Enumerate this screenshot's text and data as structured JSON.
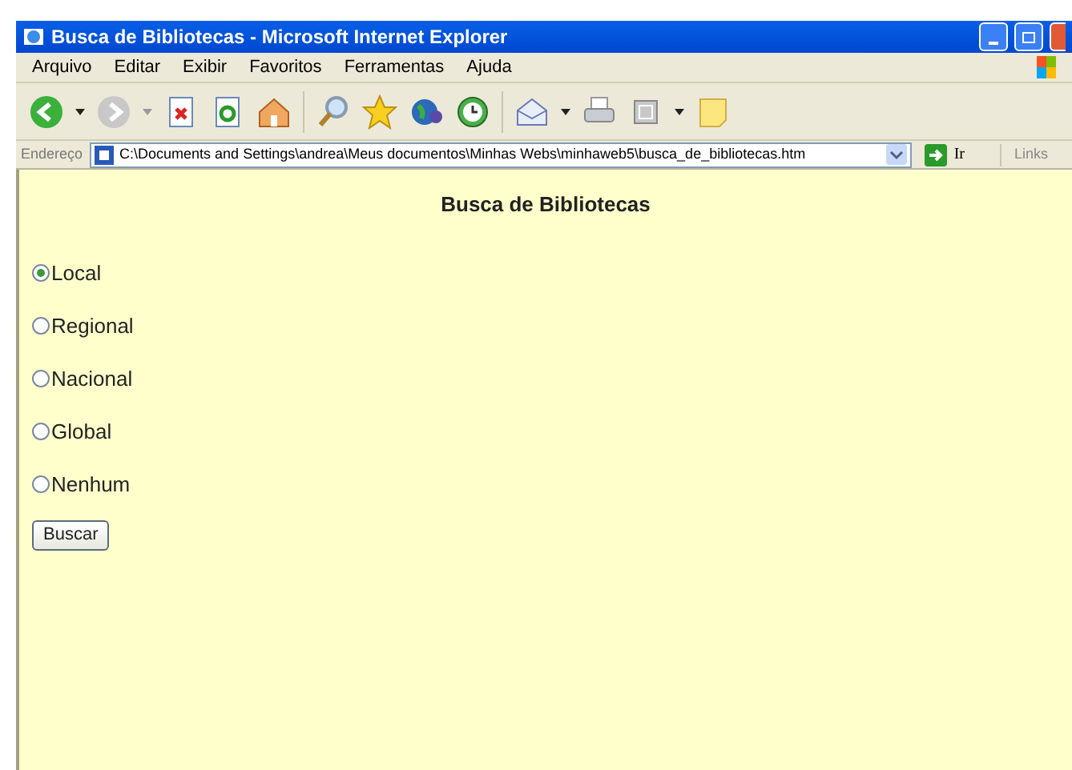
{
  "window": {
    "title": "Busca de Bibliotecas - Microsoft Internet Explorer"
  },
  "menu": [
    "Arquivo",
    "Editar",
    "Exibir",
    "Favoritos",
    "Ferramentas",
    "Ajuda"
  ],
  "address_bar": {
    "label": "Endereço",
    "value": "C:\\Documents and Settings\\andrea\\Meus documentos\\Minhas Webs\\minhaweb5\\busca_de_bibliotecas.htm",
    "go": "Ir",
    "links": "Links"
  },
  "page": {
    "heading": "Busca de Bibliotecas",
    "options": [
      {
        "label": "Local",
        "selected": true
      },
      {
        "label": "Regional",
        "selected": false
      },
      {
        "label": "Nacional",
        "selected": false
      },
      {
        "label": "Global",
        "selected": false
      },
      {
        "label": "Nenhum",
        "selected": false
      }
    ],
    "button": "Buscar"
  }
}
